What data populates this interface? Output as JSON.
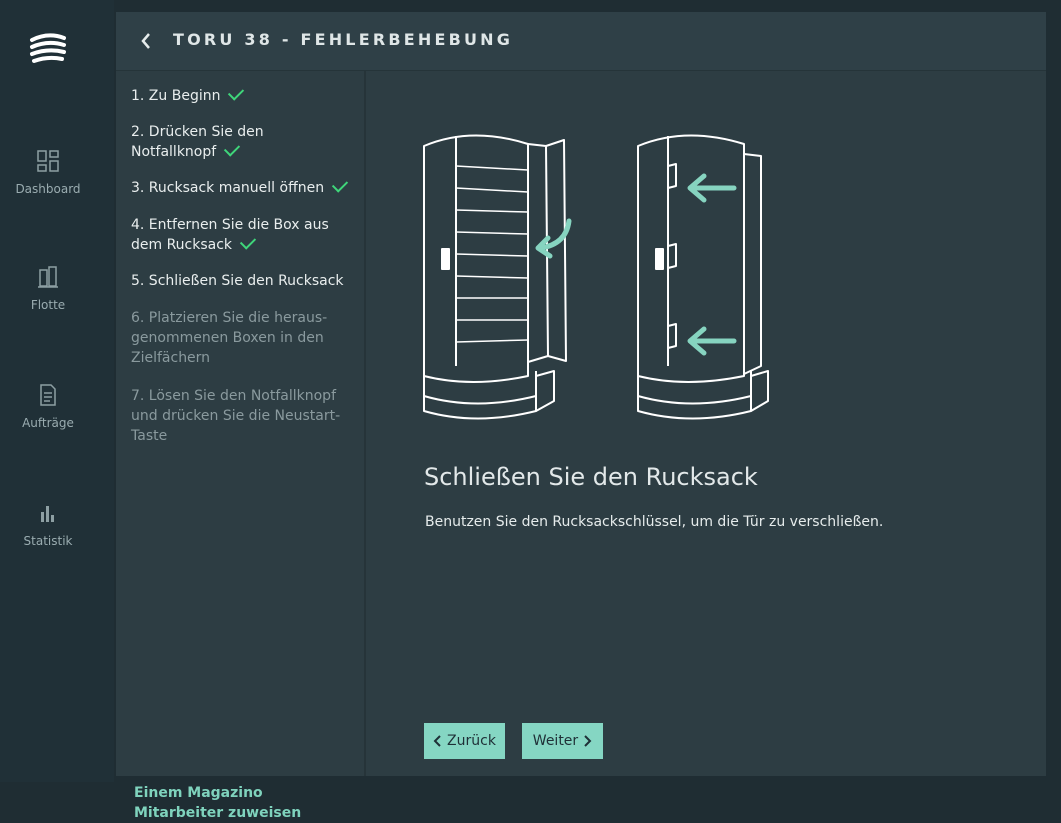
{
  "sidebar": {
    "items": [
      {
        "label": "Dashboard",
        "icon": "dashboard-icon"
      },
      {
        "label": "Flotte",
        "icon": "fleet-icon"
      },
      {
        "label": "Aufträge",
        "icon": "document-icon"
      },
      {
        "label": "Statistik",
        "icon": "bar-chart-icon"
      }
    ]
  },
  "header": {
    "title": "TORU 38 - FEHLERBEHEBUNG"
  },
  "steps": [
    {
      "text": "1. Zu Beginn",
      "done": true
    },
    {
      "text": "2. Drücken Sie den Notfallknopf",
      "done": true
    },
    {
      "text": "3. Rucksack manuell öffnen",
      "done": true
    },
    {
      "text": "4. Entfernen Sie die Box aus dem Rucksack",
      "done": true
    },
    {
      "text": "5. Schließen Sie den Rucksack",
      "done": false,
      "current": true
    },
    {
      "text": "6. Platzieren Sie die heraus-genommenen Boxen in den Zielfächern",
      "done": false
    },
    {
      "text": "7. Lösen Sie den Notfallknopf und drücken Sie die Neustart-Taste",
      "done": false
    }
  ],
  "assign_link": "Einem Magazino Mitarbeiter zuweisen",
  "content": {
    "title": "Schließen Sie den Rucksack",
    "description": "Benutzen Sie den Rucksackschlüssel, um die Tür zu verschließen."
  },
  "buttons": {
    "back": "Zurück",
    "next": "Weiter"
  },
  "colors": {
    "accent": "#85d6c3",
    "check": "#3fd67a",
    "link": "#7fd3bd"
  }
}
